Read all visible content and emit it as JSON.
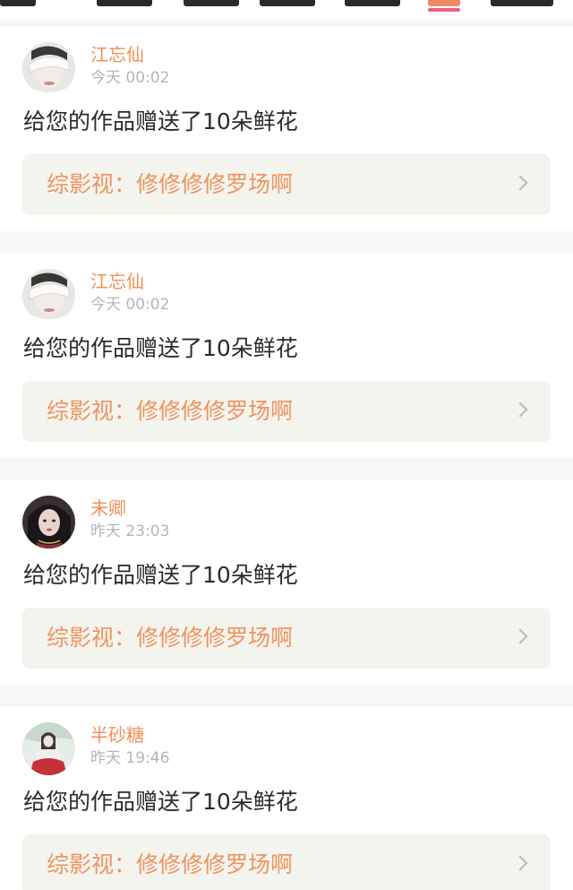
{
  "tabs": {
    "active_underline_color": "#f05c8c",
    "active_tab_color": "#f08a63"
  },
  "notifications": [
    {
      "sender": "江忘仙",
      "time": "今天 00:02",
      "message": "给您的作品赠送了10朵鲜花",
      "work": "综影视：修修修修罗场啊",
      "avatar_icon": "avatar-white-blindfold"
    },
    {
      "sender": "江忘仙",
      "time": "今天 00:02",
      "message": "给您的作品赠送了10朵鲜花",
      "work": "综影视：修修修修罗场啊",
      "avatar_icon": "avatar-white-blindfold"
    },
    {
      "sender": "未卿",
      "time": "昨天 23:03",
      "message": "给您的作品赠送了10朵鲜花",
      "work": "综影视：修修修修罗场啊",
      "avatar_icon": "avatar-dark-hair"
    },
    {
      "sender": "半砂糖",
      "time": "昨天 19:46",
      "message": "给您的作品赠送了10朵鲜花",
      "work": "综影视：修修修修罗场啊",
      "avatar_icon": "avatar-red-dress"
    }
  ],
  "colors": {
    "sender": "#f09056",
    "work_title": "#ef9360",
    "link_background": "#f4f4ee",
    "time": "#b5b5b5"
  }
}
